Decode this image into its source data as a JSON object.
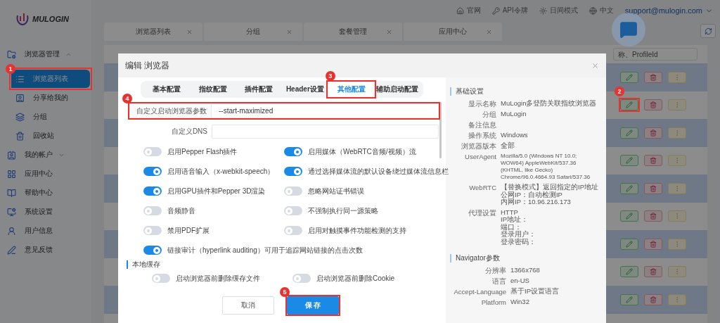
{
  "header": {
    "logo": "MULOGIN",
    "links": [
      {
        "label": "官网"
      },
      {
        "label": "API令牌"
      },
      {
        "label": "日间模式"
      },
      {
        "label": "中文"
      }
    ],
    "account": "support@mulogin.com"
  },
  "sidebar": {
    "items": [
      {
        "label": "浏览器管理",
        "kind": "group",
        "expanded": true,
        "selected": false,
        "children": [
          {
            "label": "浏览器列表",
            "selected": true,
            "annotation": "1"
          },
          {
            "label": "分享给我的",
            "selected": false
          },
          {
            "label": "分组",
            "selected": false
          },
          {
            "label": "回收站",
            "selected": false
          }
        ]
      },
      {
        "label": "我的帐户",
        "kind": "group",
        "expanded": false,
        "selected": false
      },
      {
        "label": "应用中心",
        "kind": "link",
        "selected": false
      },
      {
        "label": "帮助中心",
        "kind": "link",
        "selected": false
      },
      {
        "label": "系统设置",
        "kind": "link",
        "selected": false
      },
      {
        "label": "用户信息",
        "kind": "link",
        "selected": false
      },
      {
        "label": "意见反馈",
        "kind": "link",
        "selected": false
      }
    ]
  },
  "tabs": [
    {
      "label": "浏览器列表"
    },
    {
      "label": "分组"
    },
    {
      "label": "套餐管理"
    },
    {
      "label": "应用中心"
    }
  ],
  "search": {
    "placeholder": "称、ProfileId"
  },
  "table": {
    "rows": [
      {
        "shaded": true
      },
      {
        "shaded": false,
        "edit_annotation": "2"
      },
      {
        "shaded": true
      },
      {
        "shaded": false
      },
      {
        "shaded": true
      },
      {
        "shaded": false
      },
      {
        "shaded": true
      },
      {
        "shaded": false
      },
      {
        "shaded": true
      }
    ]
  },
  "modal": {
    "title": "编辑 浏览器",
    "tabs": [
      {
        "label": "基本配置",
        "selected": false
      },
      {
        "label": "指纹配置",
        "selected": false
      },
      {
        "label": "插件配置",
        "selected": false
      },
      {
        "label": "Header设置",
        "selected": false
      },
      {
        "label": "其他配置",
        "selected": true,
        "annotation": "3"
      },
      {
        "label": "辅助启动配置",
        "selected": false
      }
    ],
    "launch_args": {
      "label": "自定义启动浏览器参数",
      "value": "--start-maximized",
      "annotation": "4"
    },
    "dns": {
      "label": "自定义DNS"
    },
    "toggles": [
      {
        "label": "启用Pepper Flash插件",
        "on": false
      },
      {
        "label": "启用媒体（WebRTC音频/视频）流",
        "on": true
      },
      {
        "label": "启用语音输入（x-webkit-speech）",
        "on": true
      },
      {
        "label": "通过选择媒体流的默认设备绕过媒体流信息栏",
        "on": true
      },
      {
        "label": "启用GPU插件和Pepper 3D渲染",
        "on": true
      },
      {
        "label": "忽略网站证书错误",
        "on": false
      },
      {
        "label": "音频静音",
        "on": false
      },
      {
        "label": "不强制执行同一源策略",
        "on": false
      },
      {
        "label": "禁用PDF扩展",
        "on": false
      },
      {
        "label": "启用对触摸事件功能检测的支持",
        "on": false
      },
      {
        "label": "链接审计（hyperlink auditing）可用于追踪网站链接的点击次数",
        "on": true
      }
    ],
    "cache": {
      "title": "本地缓存",
      "toggles": [
        {
          "label": "启动浏览器前删除缓存文件",
          "on": false
        },
        {
          "label": "启动浏览器前删除Cookie",
          "on": false
        }
      ]
    },
    "buttons": [
      {
        "label": "取消",
        "kind": "secondary"
      },
      {
        "label": "保 存",
        "kind": "primary",
        "annotation": "5"
      }
    ],
    "summary": [
      {
        "title": "基础设置",
        "rows": [
          {
            "label": "显示名称",
            "kind": "text",
            "lines": [
              "MuLogin多登防关联指纹浏览器"
            ]
          },
          {
            "label": "分组",
            "kind": "text",
            "lines": [
              "MuLogin"
            ]
          },
          {
            "label": "备注信息",
            "lines": []
          },
          {
            "label": "操作系统",
            "kind": "text",
            "lines": [
              "Windows"
            ]
          },
          {
            "label": "浏览器版本",
            "kind": "text",
            "lines": [
              "全部"
            ]
          },
          {
            "label": "UserAgent",
            "kind": "ua",
            "lines": [
              "Mozilla/5.0 (Windows NT 10.0;",
              "WOW64) AppleWebKit/537.36",
              "(KHTML, like Gecko)",
              "Chrome/96.0.4664.93 Safari/537.36"
            ]
          },
          {
            "label": "WebRTC",
            "kind": "text",
            "lines": [
              "【替换模式】返回指定的IP地址",
              "公网IP：自动检测IP",
              "内网IP：10.96.216.173"
            ]
          },
          {
            "label": "代理设置",
            "kind": "text",
            "lines": [
              "HTTP",
              "IP地址：",
              "端口：",
              "登录用户：",
              "登录密码："
            ]
          }
        ]
      },
      {
        "title": "Navigator参数",
        "rows": [
          {
            "label": "分辨率",
            "kind": "text",
            "lines": [
              "1366x768"
            ]
          },
          {
            "label": "语言",
            "kind": "text",
            "lines": [
              "en-US"
            ]
          },
          {
            "label": "Accept-Language",
            "kind": "text",
            "lines": [
              "基于IP设置语言"
            ]
          },
          {
            "label": "Platform",
            "kind": "text",
            "lines": [
              "Win32"
            ]
          }
        ]
      }
    ]
  }
}
